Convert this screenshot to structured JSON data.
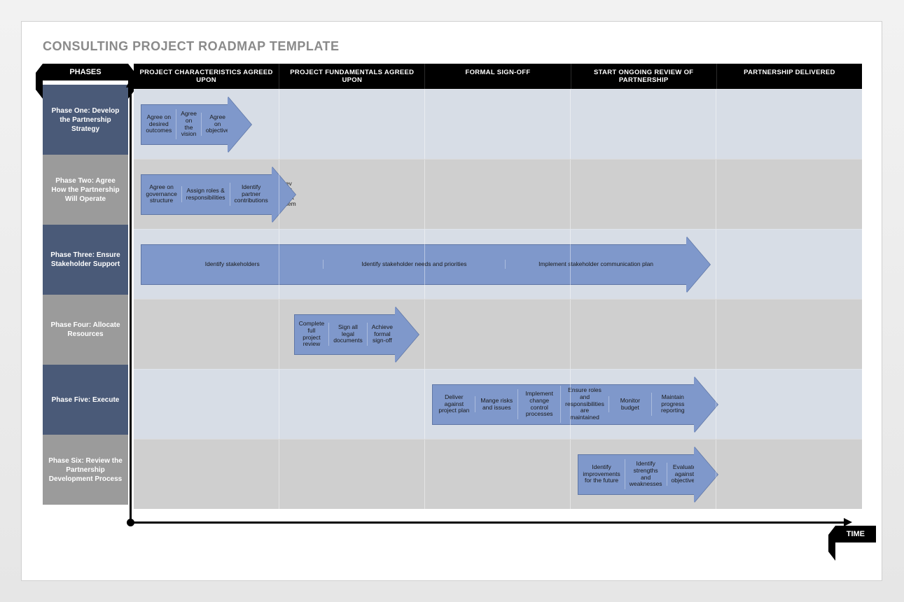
{
  "title": "CONSULTING PROJECT ROADMAP TEMPLATE",
  "axis": {
    "y": "PHASES",
    "x": "TIME"
  },
  "columns": [
    "PROJECT CHARACTERISTICS AGREED UPON",
    "PROJECT FUNDAMENTALS AGREED UPON",
    "FORMAL SIGN-OFF",
    "START ONGOING REVIEW OF PARTNERSHIP",
    "PARTNERSHIP DELIVERED"
  ],
  "phases": [
    {
      "name": "Phase One: Develop the Partnership Strategy",
      "tone": "dark"
    },
    {
      "name": "Phase Two: Agree How the Partnership Will Operate",
      "tone": "gray"
    },
    {
      "name": "Phase Three: Ensure Stakeholder Support",
      "tone": "dark"
    },
    {
      "name": "Phase Four: Allocate Resources",
      "tone": "gray"
    },
    {
      "name": "Phase Five: Execute",
      "tone": "dark"
    },
    {
      "name": "Phase Six: Review the Partnership Development Process",
      "tone": "gray"
    }
  ],
  "bars": [
    {
      "row": 0,
      "leftPct": 1,
      "widthPct": 12,
      "items": [
        "Agree on desired outcomes",
        "Agree on the vision",
        "Agree on objective"
      ]
    },
    {
      "row": 1,
      "leftPct": 1,
      "widthPct": 18,
      "items": [
        "Agree on governance structure",
        "Assign roles & responsibilities",
        "Identify partner contributions",
        "Dev perf mgmt system"
      ]
    },
    {
      "row": 2,
      "leftPct": 1,
      "widthPct": 75,
      "items": [
        "Identify stakeholders",
        "Identify stakeholder needs and priorities",
        "Implement stakeholder communication plan"
      ]
    },
    {
      "row": 3,
      "leftPct": 22,
      "widthPct": 14,
      "items": [
        "Complete full project review",
        "Sign all legal documents",
        "Achieve formal sign-off"
      ]
    },
    {
      "row": 4,
      "leftPct": 41,
      "widthPct": 36,
      "items": [
        "Deliver against project plan",
        "Mange risks and issues",
        "Implement change control processes",
        "Ensure roles and responsibilities are maintained",
        "Monitor budget",
        "Maintain progress reporting"
      ]
    },
    {
      "row": 5,
      "leftPct": 61,
      "widthPct": 16,
      "items": [
        "Identify improvements for the future",
        "Identify strengths and weaknesses",
        "Evaluate against objectives"
      ]
    }
  ]
}
